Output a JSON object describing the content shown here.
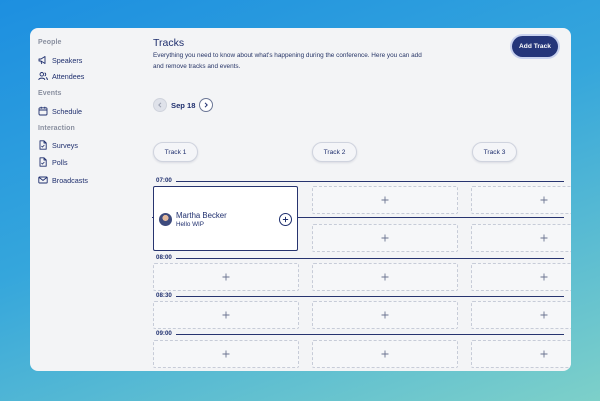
{
  "sidebar": {
    "sections": [
      {
        "title": "People",
        "items": [
          {
            "label": "Speakers",
            "icon": "megaphone-icon"
          },
          {
            "label": "Attendees",
            "icon": "users-icon"
          }
        ]
      },
      {
        "title": "Events",
        "items": [
          {
            "label": "Schedule",
            "icon": "calendar-icon"
          }
        ]
      },
      {
        "title": "Interaction",
        "items": [
          {
            "label": "Surveys",
            "icon": "document-icon"
          },
          {
            "label": "Polls",
            "icon": "document-icon"
          },
          {
            "label": "Broadcasts",
            "icon": "mail-icon"
          }
        ]
      }
    ]
  },
  "header": {
    "title": "Tracks",
    "description": "Everything you need to know about what's happening during the conference. Here you can add and remove tracks and events.",
    "add_button": "Add Track"
  },
  "date_nav": {
    "date": "Sep 18"
  },
  "tracks": [
    "Track 1",
    "Track 2",
    "Track 3"
  ],
  "times": [
    "07:00",
    "08:00",
    "08:30",
    "09:00"
  ],
  "event": {
    "name": "Martha Becker",
    "subtitle": "Hello WIP"
  },
  "colors": {
    "accent": "#24357a",
    "background_gradient_start": "#1d8fe0",
    "background_gradient_end": "#7dd0c9"
  }
}
